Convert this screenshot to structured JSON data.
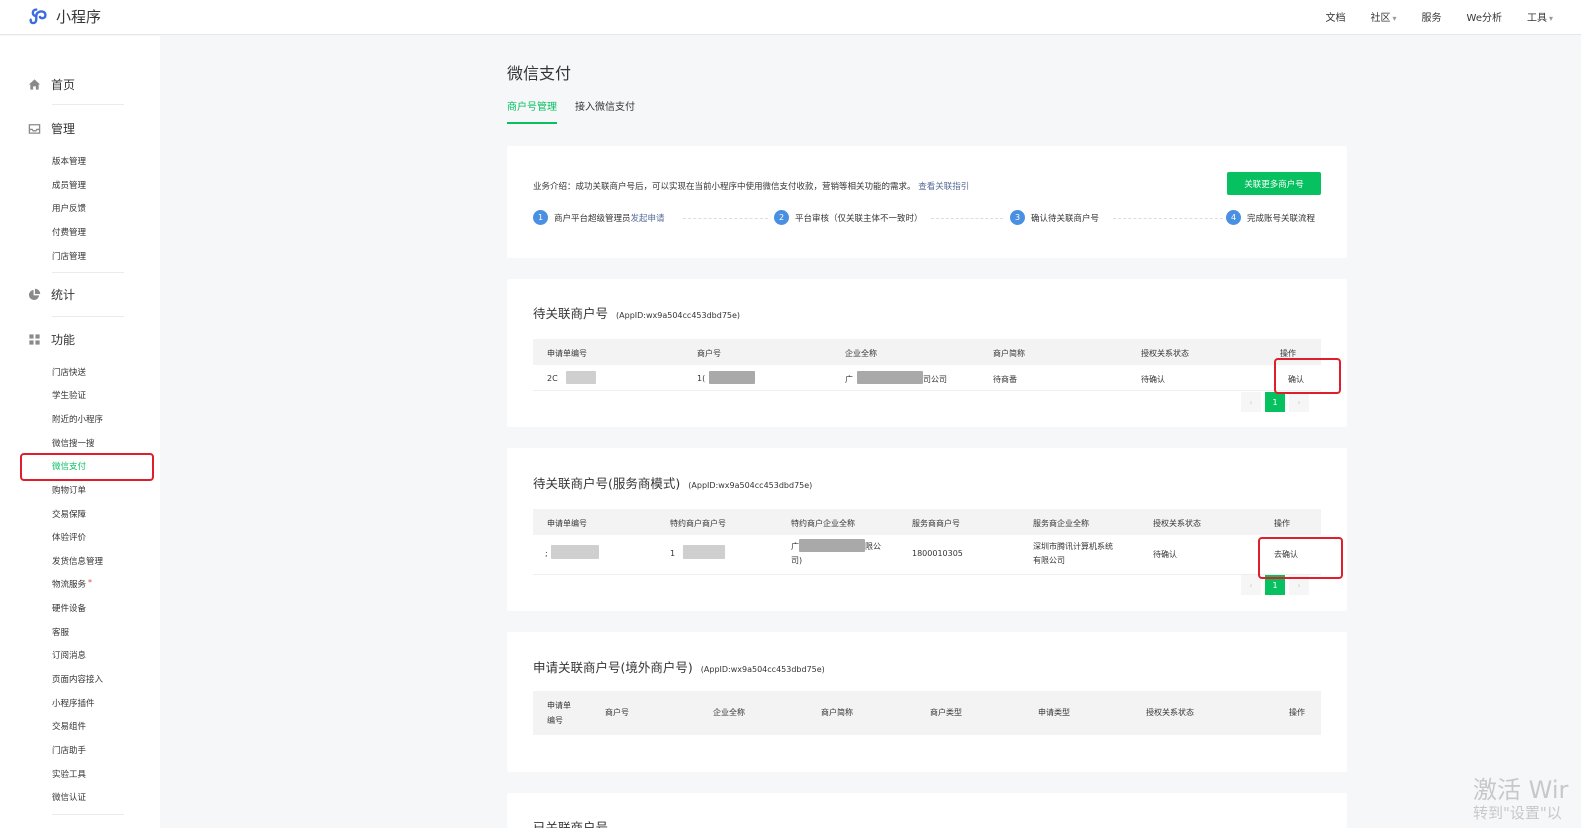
{
  "app": {
    "title": "小程序"
  },
  "topnav": [
    "文档",
    "社区",
    "服务",
    "We分析",
    "工具"
  ],
  "sidebar": {
    "home": "首页",
    "manage": {
      "label": "管理",
      "items": [
        "版本管理",
        "成员管理",
        "用户反馈",
        "付费管理",
        "门店管理"
      ]
    },
    "stats": "统计",
    "features": {
      "label": "功能",
      "items": [
        "门店快送",
        "学生验证",
        "附近的小程序",
        "微信搜一搜",
        "微信支付",
        "购物订单",
        "交易保障",
        "体验评价",
        "发货信息管理",
        "物流服务",
        "硬件设备",
        "客服",
        "订阅消息",
        "页面内容接入",
        "小程序插件",
        "交易组件",
        "门店助手",
        "实验工具",
        "微信认证"
      ]
    },
    "badge": "*"
  },
  "page": {
    "title": "微信支付",
    "tabs": [
      "商户号管理",
      "接入微信支付"
    ]
  },
  "intro": {
    "text": "业务介绍：成功关联商户号后，可以实现在当前小程序中使用微信支付收款，营销等相关功能的需求。",
    "link": "查看关联指引",
    "button": "关联更多商户号",
    "steps": [
      {
        "n": "1",
        "text": "商户平台超级管理员",
        "link": "发起申请"
      },
      {
        "n": "2",
        "text": "平台审核（仅关联主体不一致时）",
        "link": ""
      },
      {
        "n": "3",
        "text": "确认待关联商户号",
        "link": ""
      },
      {
        "n": "4",
        "text": "完成账号关联流程",
        "link": ""
      }
    ]
  },
  "pending": {
    "title": "待关联商户号",
    "appid": "(AppID:wx9a504cc453dbd75e)",
    "columns": [
      "申请单编号",
      "商户号",
      "企业全称",
      "商户简称",
      "授权关系状态",
      "操作"
    ],
    "row": {
      "id": "2C",
      "mch": "1(",
      "corp_prefix": "广",
      "corp_suffix": "司公司",
      "short": "待商番",
      "status": "待确认",
      "action": "确认"
    },
    "page": "1"
  },
  "service": {
    "title": "待关联商户号(服务商模式)",
    "appid": "(AppID:wx9a504cc453dbd75e)",
    "columns": [
      "申请单编号",
      "特约商户商户号",
      "特约商户企业全称",
      "服务商商户号",
      "服务商企业全称",
      "授权关系状态",
      "操作"
    ],
    "row": {
      "id": ";",
      "mch": "1",
      "corp_prefix": "广",
      "corp_suffix": "限公",
      "corp_line2": "司)",
      "sp_mch": "1800010305",
      "sp_corp_1": "深圳市腾讯计算机系统",
      "sp_corp_2": "有限公司",
      "status": "待确认",
      "action": "去确认"
    },
    "page": "1"
  },
  "overseas": {
    "title": "申请关联商户号(境外商户号)",
    "appid": "(AppID:wx9a504cc453dbd75e)",
    "columns": [
      "申请单",
      "编号",
      "商户号",
      "企业全称",
      "商户简称",
      "商户类型",
      "申请类型",
      "授权关系状态",
      "操作"
    ]
  },
  "next": {
    "title": "已关联商户号"
  },
  "watermark": {
    "line1": "激活 Wir",
    "line2": "转到\"设置\"以"
  }
}
